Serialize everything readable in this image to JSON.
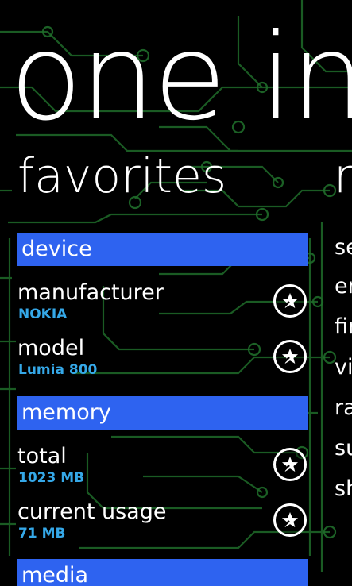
{
  "app_title": "one info",
  "pivots": {
    "current": "favorites",
    "next": "more"
  },
  "favorites": {
    "groups": {
      "device": {
        "header": "device",
        "items": [
          {
            "label": "manufacturer",
            "value": "NOKIA"
          },
          {
            "label": "model",
            "value": "Lumia 800"
          }
        ]
      },
      "memory": {
        "header": "memory",
        "items": [
          {
            "label": "total",
            "value": "1023 MB"
          },
          {
            "label": "current usage",
            "value": "71 MB"
          }
        ]
      },
      "media": {
        "header": "media"
      }
    }
  },
  "next_pivot_items": [
    "se",
    "er",
    "fir",
    "vi",
    "ra",
    "su",
    "sh"
  ],
  "icons": {
    "favorite": "star-in-circle-icon"
  },
  "colors": {
    "background": "#000000",
    "group_header": "#2e63f0",
    "value_text": "#35a8e8",
    "circuit": "#1f6b2a"
  }
}
